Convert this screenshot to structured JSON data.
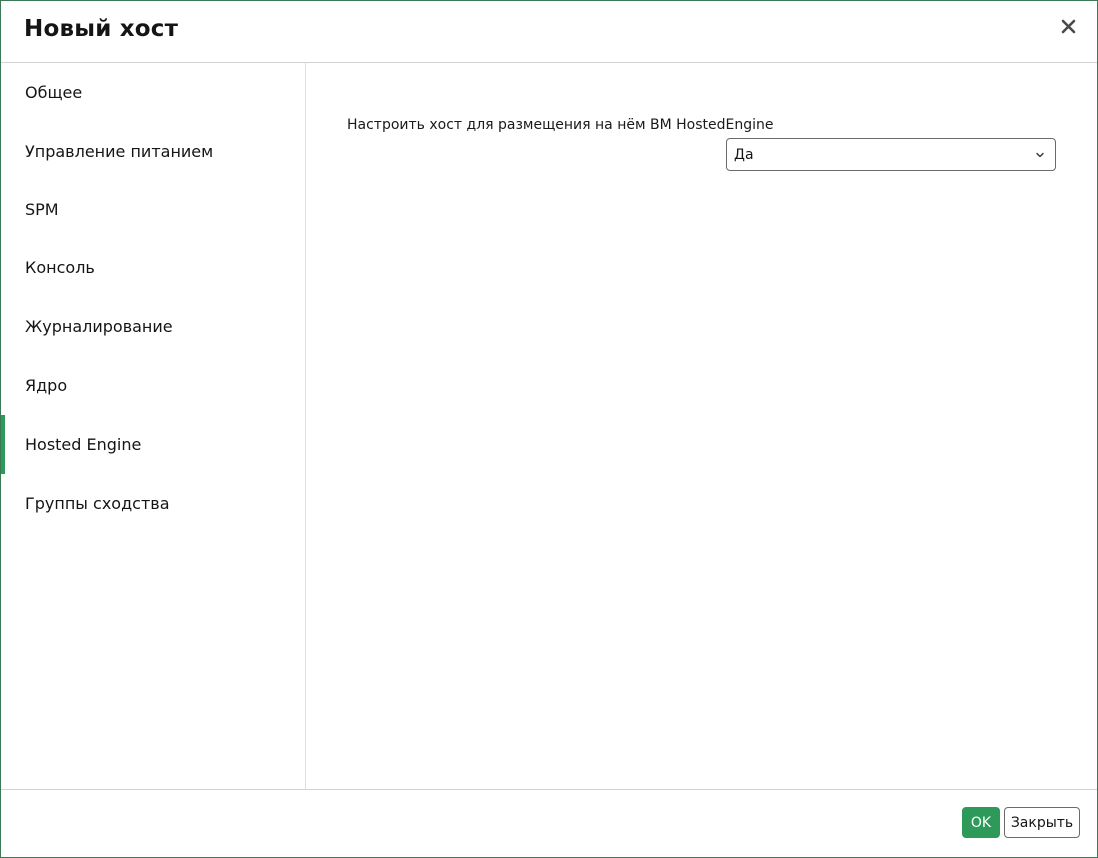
{
  "dialog": {
    "title": "Новый хост",
    "close_icon": "close-icon"
  },
  "sidebar": {
    "items": [
      {
        "label": "Общее"
      },
      {
        "label": "Управление питанием"
      },
      {
        "label": "SPM"
      },
      {
        "label": "Консоль"
      },
      {
        "label": "Журналирование"
      },
      {
        "label": "Ядро"
      },
      {
        "label": "Hosted Engine",
        "active": true
      },
      {
        "label": "Группы сходства"
      }
    ],
    "active_color": "#2e9a5a"
  },
  "content": {
    "field_label": "Настроить хост для размещения на нём ВМ HostedEngine",
    "select_value": "Да",
    "select_icon": "chevron-down-icon"
  },
  "footer": {
    "ok_label": "OK",
    "close_label": "Закрыть"
  },
  "colors": {
    "primary": "#2e9a5a",
    "border": "#d2d2d2",
    "text": "#151515"
  }
}
